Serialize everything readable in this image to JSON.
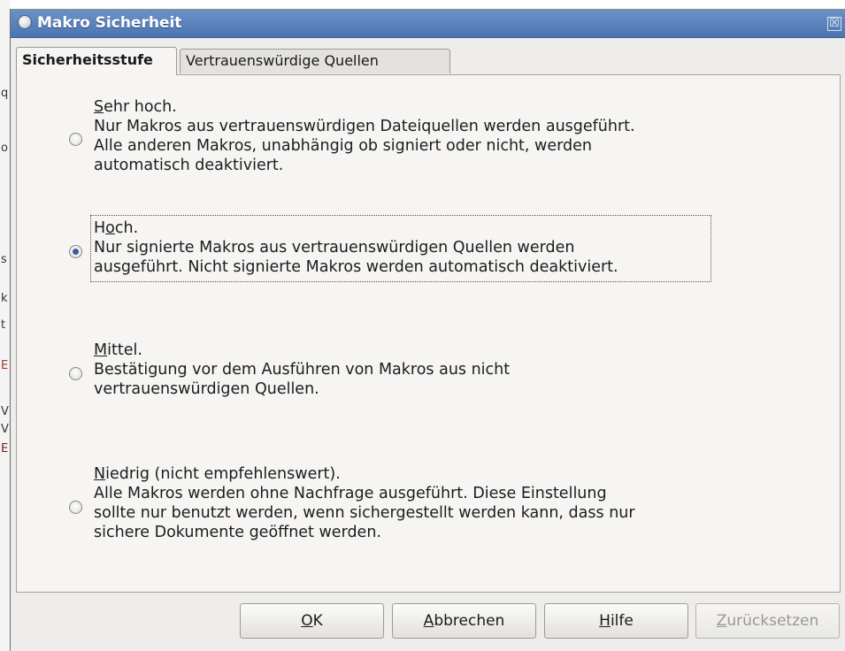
{
  "window": {
    "title": "Makro Sicherheit",
    "close_glyph": "☒"
  },
  "background": {
    "fragments": [
      "q",
      "o",
      "s",
      "k",
      "t",
      "E",
      "V",
      "V",
      "E"
    ]
  },
  "tabs": [
    {
      "label": "Sicherheitsstufe",
      "active": true
    },
    {
      "label": "Vertrauenswürdige Quellen",
      "active": false
    }
  ],
  "options": [
    {
      "mnemonic": "S",
      "title_rest": "ehr hoch.",
      "lines": [
        "Nur Makros aus vertrauenswürdigen Dateiquellen werden ausgeführt.",
        "Alle anderen Makros, unabhängig ob signiert oder nicht, werden",
        "automatisch deaktiviert."
      ],
      "selected": false
    },
    {
      "mnemonic_prefix": "H",
      "mnemonic": "o",
      "title_rest": "ch.",
      "lines": [
        "Nur signierte Makros aus vertrauenswürdigen Quellen werden",
        "ausgeführt. Nicht signierte Makros werden automatisch deaktiviert."
      ],
      "selected": true
    },
    {
      "mnemonic": "M",
      "title_rest": "ittel.",
      "lines": [
        "Bestätigung vor dem Ausführen von Makros aus nicht",
        "vertrauenswürdigen Quellen."
      ],
      "selected": false
    },
    {
      "mnemonic": "N",
      "title_rest": "iedrig (nicht empfehlenswert).",
      "lines": [
        "Alle Makros werden ohne Nachfrage ausgeführt. Diese Einstellung",
        "sollte nur benutzt werden, wenn sichergestellt werden kann, dass nur",
        "sichere Dokumente geöffnet werden."
      ],
      "selected": false
    }
  ],
  "buttons": {
    "ok": {
      "mnemonic": "O",
      "rest": "K"
    },
    "cancel": {
      "mnemonic": "A",
      "rest": "bbrechen"
    },
    "help": {
      "mnemonic": "H",
      "rest": "ilfe"
    },
    "reset": {
      "mnemonic": "Z",
      "rest": "urücksetzen",
      "disabled": true
    }
  },
  "icons": {
    "title_icon": "macro-security-icon",
    "close_icon": "close-icon"
  }
}
